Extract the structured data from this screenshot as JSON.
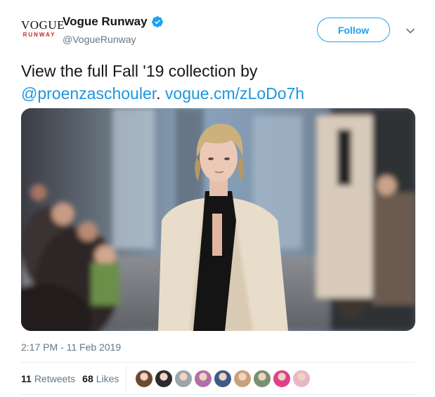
{
  "account": {
    "logo_line1": "VOGUE",
    "logo_line2": "RUNWAY",
    "display_name": "Vogue Runway",
    "handle": "@VogueRunway",
    "verified": true
  },
  "follow_button": {
    "label": "Follow"
  },
  "tweet": {
    "text_plain": "View the full Fall '19 collection by",
    "mention": "@proenzaschouler",
    "separator": ".",
    "link": "vogue.cm/zLoDo7h"
  },
  "timestamp": "2:17 PM - 11 Feb 2019",
  "stats": {
    "retweets_count": "11",
    "retweets_label": "Retweets",
    "likes_count": "68",
    "likes_label": "Likes"
  },
  "liker_avatars": [
    {
      "color": "#6b4a2f"
    },
    {
      "color": "#2b2b2b"
    },
    {
      "color": "#9aa5ae"
    },
    {
      "color": "#b36fa8"
    },
    {
      "color": "#3c5a8a"
    },
    {
      "color": "#c9a07d"
    },
    {
      "color": "#7a8f6e"
    },
    {
      "color": "#e0408a"
    },
    {
      "color": "#e8b7c6"
    }
  ],
  "colors": {
    "link": "#1b95e0",
    "follow": "#1da1f2",
    "secondary_text": "#657786",
    "verified": "#1da1f2"
  }
}
